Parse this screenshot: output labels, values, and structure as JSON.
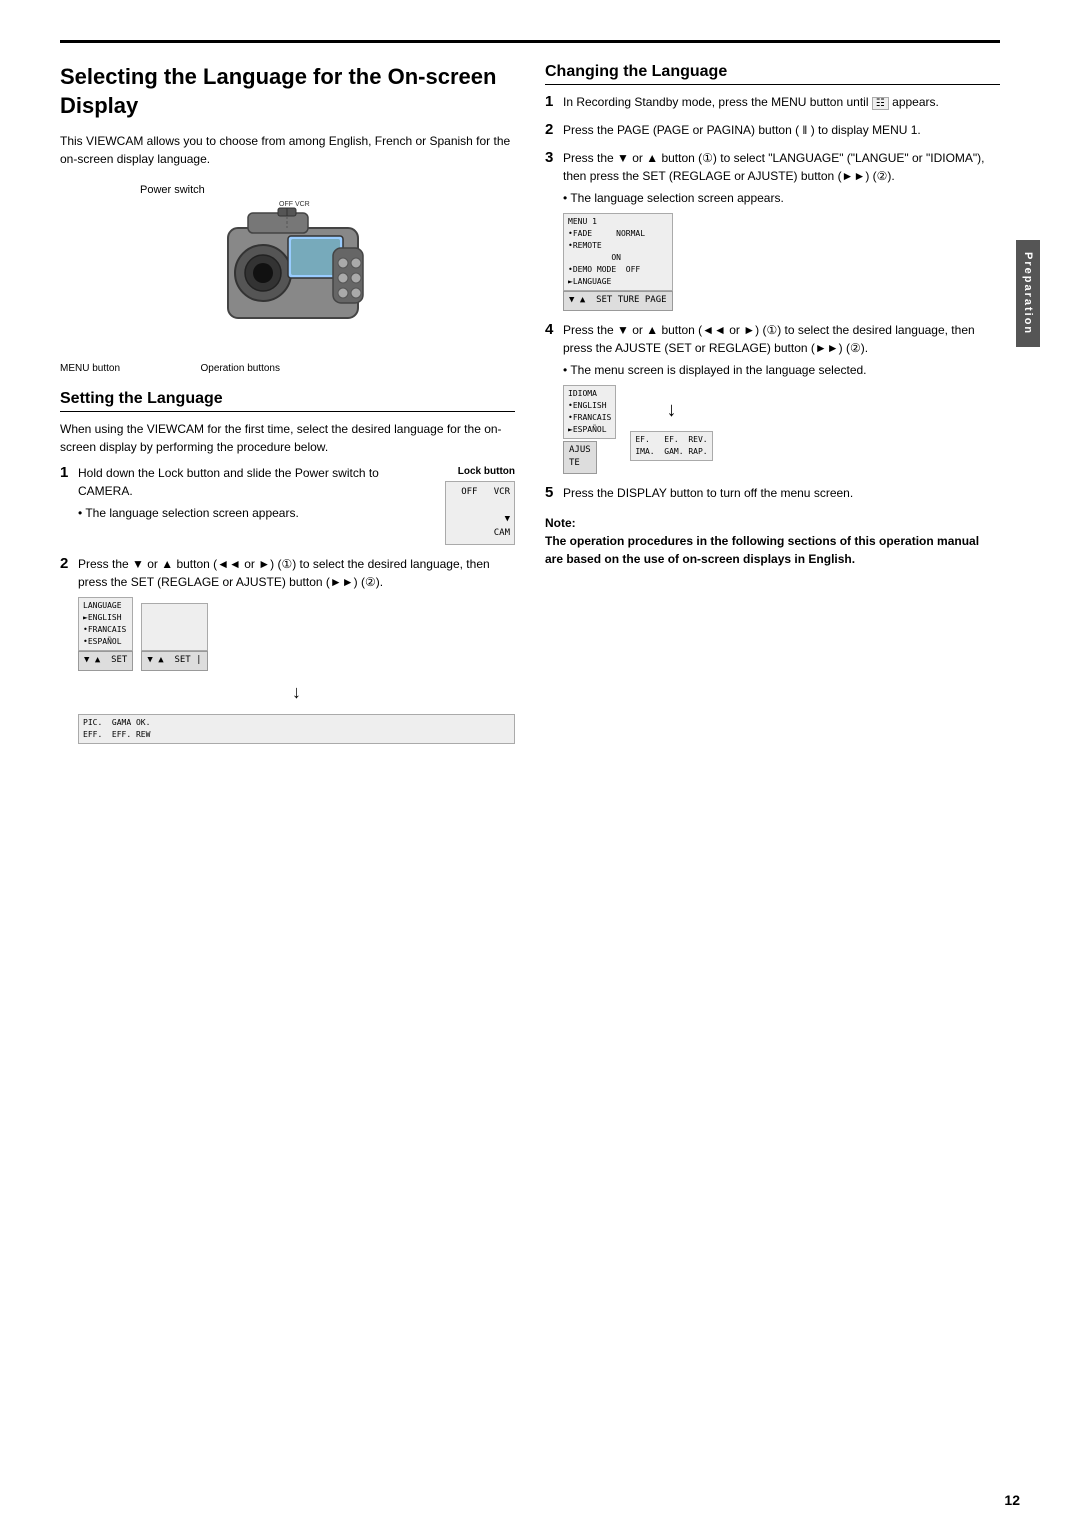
{
  "page": {
    "top_rule": true,
    "page_number": "12",
    "side_tab": "Preparation"
  },
  "left_col": {
    "title": "Selecting the Language for the On-screen Display",
    "intro": "This VIEWCAM allows you to choose from among English, French or Spanish for the on-screen display language.",
    "camera_labels": {
      "power_switch": "Power switch",
      "menu_button": "MENU button",
      "operation_buttons": "Operation buttons"
    },
    "setting_section": {
      "heading": "Setting the Language",
      "intro": "When using the VIEWCAM for the first time, select the desired language for the on-screen display by performing the procedure below."
    },
    "steps": [
      {
        "num": "1",
        "text": "Hold down the Lock button and slide the Power switch to CAMERA.",
        "side_label": "Lock button",
        "sub_bullet": "The language selection screen appears.",
        "lock_diagram": "OFF   VCR\n\n\nCAM"
      },
      {
        "num": "2",
        "text": "Press the ▼ or ▲ button (◄◄ or ►) (①) to select the desired language, then press the SET (REGLAGE or AJUSTE) button (►►) (②).",
        "diagrams": {
          "lcd1": "LANGUAGE\n►ENGLISH\n•FRANCAIS\n•ESPAÑOL",
          "ctrl1": "▼ ▲  SET",
          "lcd2": "",
          "ctrl2": "▼ ▲  SET |",
          "arrow": "↓",
          "lcd3": "PIC.  GAMA OK.\nEFF.  EFF. REW"
        }
      }
    ]
  },
  "right_col": {
    "heading": "Changing the Language",
    "steps": [
      {
        "num": "1",
        "text": "In Recording Standby mode, press the MENU button until",
        "icon_text": "appears."
      },
      {
        "num": "2",
        "text": "Press the PAGE (PAGE or PAGINA) button ( ‖ ) to display MENU 1."
      },
      {
        "num": "3",
        "text": "Press the ▼ or ▲ button (①) to select \"LANGUAGE\" (\"LANGUE\" or \"IDIOMA\"), then press the SET (REGLAGE or AJUSTE) button (►►) (②).",
        "sub_bullet": "The language selection screen appears.",
        "menu_diagram": {
          "title": "MENU 1",
          "lines": [
            "•FADE     NORMAL",
            "•REMOTE",
            "         ON",
            "•DEMO MODE  OFF",
            "►LANGUAGE"
          ],
          "ctrl": "▼ ▲  SET TURE PAGE"
        }
      },
      {
        "num": "4",
        "text": "Press the ▼ or ▲ button (◄◄ or ►) (①) to select the desired language, then press the AJUSTE (SET or REGLAGE) button (►►) (②).",
        "sub_bullet": "The menu screen is displayed in the language selected.",
        "idioma_diagram": {
          "title": "IDIOMA",
          "lines": [
            "•ENGLISH",
            "•FRANCAIS",
            "►ESPAÑOL"
          ],
          "ctrl": "AJUS\nTE"
        },
        "arrow": "↓",
        "final_diagram": {
          "lines": [
            "EF.   EF.  REV.",
            "IMA.  GAM. RAP."
          ]
        }
      },
      {
        "num": "5",
        "text": "Press the DISPLAY button to turn off the menu screen."
      }
    ],
    "note": {
      "label": "Note:",
      "text": "The operation procedures in the following sections of this operation manual are based on the use of on-screen displays in English."
    }
  }
}
